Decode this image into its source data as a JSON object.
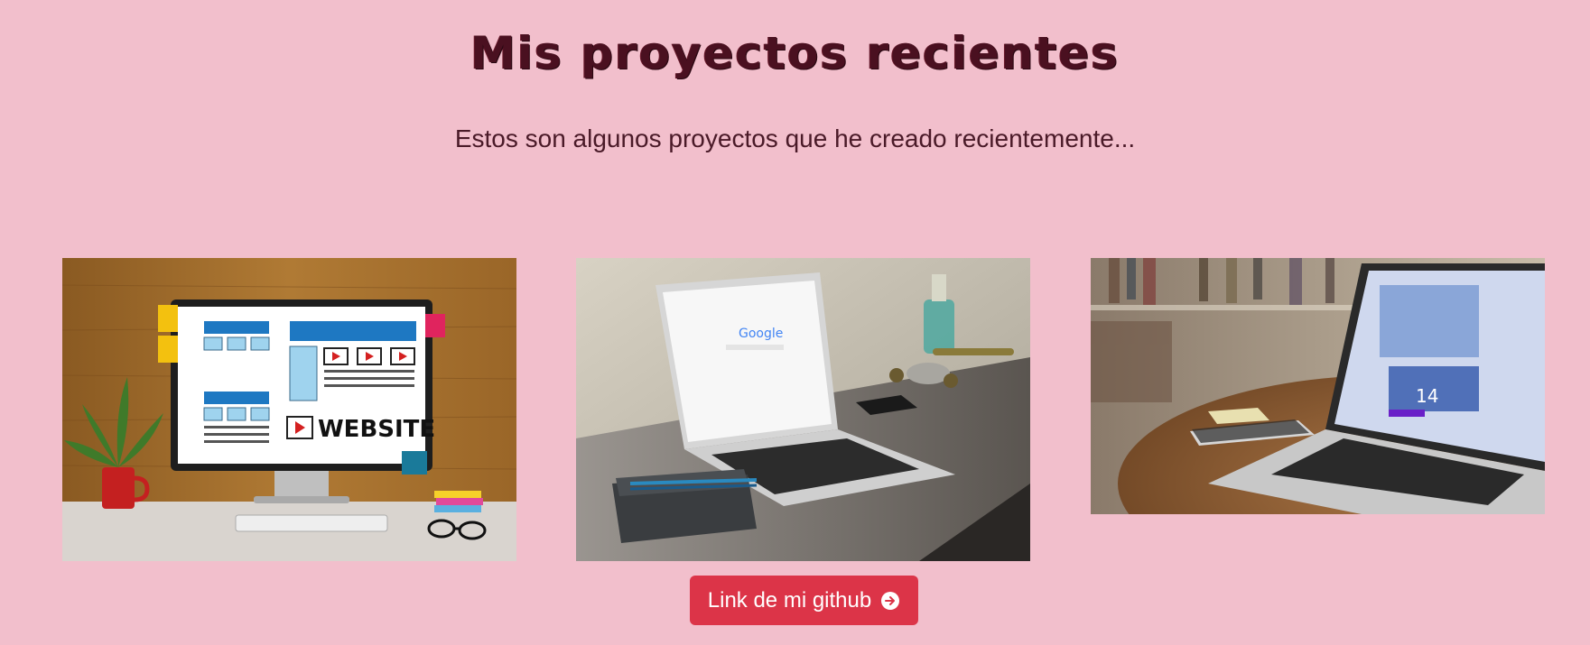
{
  "header": {
    "title": "Mis proyectos recientes",
    "subtitle": "Estos son algunos proyectos que he creado recientemente..."
  },
  "projects": [
    {
      "image": "website-design-monitor-photo",
      "screen_text": "WEBSITE"
    },
    {
      "image": "laptop-google-desk-photo",
      "screen_text": "Google"
    },
    {
      "image": "laptop-round-table-photo",
      "screen_text": "14"
    }
  ],
  "github_button": {
    "label": "Link de mi github",
    "icon": "arrow-right-circle-icon"
  },
  "colors": {
    "background": "#f2bfcc",
    "title": "#4a1020",
    "button": "#dc3448"
  }
}
